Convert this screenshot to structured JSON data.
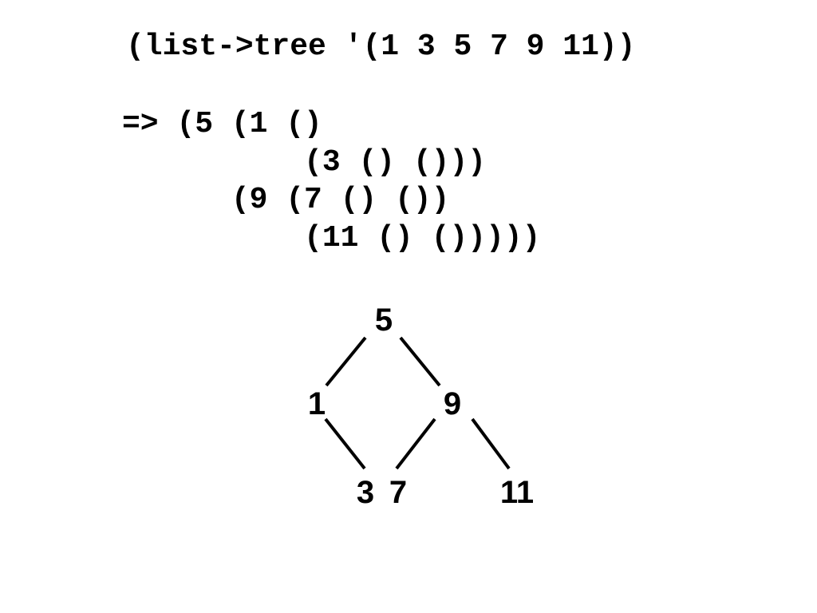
{
  "expression": "(list->tree '(1 3 5 7 9 11))",
  "result_lines": [
    "=> (5 (1 ()",
    "          (3 () ()))",
    "      (9 (7 () ())",
    "          (11 () ()))))"
  ],
  "tree": {
    "nodes": [
      "5",
      "1",
      "9",
      "3",
      "7",
      "11"
    ],
    "edges": [
      [
        "5",
        "1"
      ],
      [
        "5",
        "9"
      ],
      [
        "1",
        "3"
      ],
      [
        "9",
        "7"
      ],
      [
        "9",
        "11"
      ]
    ]
  }
}
